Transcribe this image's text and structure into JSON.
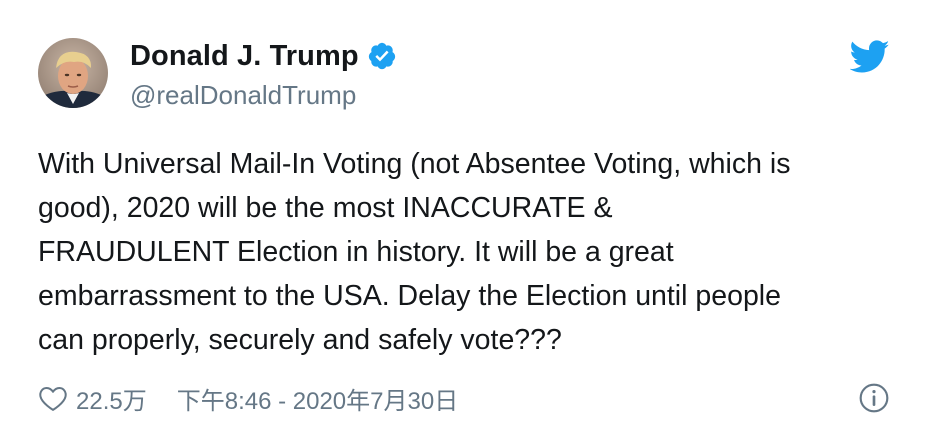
{
  "author": {
    "display_name": "Donald J. Trump",
    "handle": "@realDonaldTrump",
    "verified": true,
    "avatar_icon": "profile-photo",
    "verified_icon": "verified-checkmark-badge"
  },
  "brand": {
    "logo_icon": "twitter-bird-logo",
    "accent_color": "#1da1f2"
  },
  "tweet": {
    "text": "With Universal Mail-In Voting (not Absentee Voting, which is\ngood), 2020 will be the most INACCURATE &\nFRAUDULENT Election in history. It will be a great\nembarrassment to the USA. Delay the Election until people\ncan properly, securely and safely vote???"
  },
  "footer": {
    "like_icon": "heart-outline",
    "like_count": "22.5万",
    "timestamp": "下午8:46 - 2020年7月30日",
    "info_icon": "info-circle"
  },
  "colors": {
    "primary_text": "#14171a",
    "secondary_text": "#657786",
    "background": "#ffffff"
  }
}
